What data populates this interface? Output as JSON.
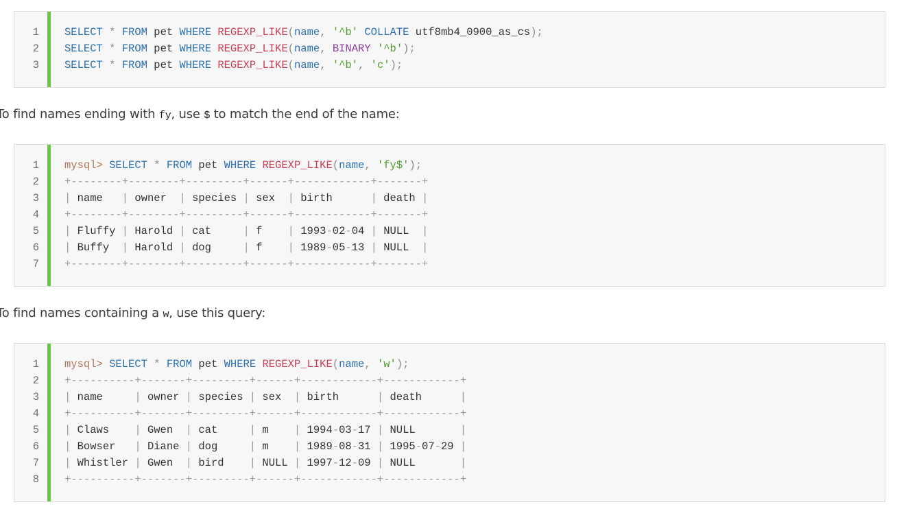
{
  "block1": {
    "lines": [
      "SELECT * FROM pet WHERE REGEXP_LIKE(name, '^b' COLLATE utf8mb4_0900_as_cs);",
      "SELECT * FROM pet WHERE REGEXP_LIKE(name, BINARY '^b');",
      "SELECT * FROM pet WHERE REGEXP_LIKE(name, '^b', 'c');"
    ]
  },
  "para1": {
    "before": "To find names ending with ",
    "code1": "fy",
    "middle": ", use ",
    "code2": "$",
    "after": " to match the end of the name:"
  },
  "block2": {
    "lines": [
      "mysql> SELECT * FROM pet WHERE REGEXP_LIKE(name, 'fy$');",
      "+--------+--------+---------+------+------------+-------+",
      "| name   | owner  | species | sex  | birth      | death |",
      "+--------+--------+---------+------+------------+-------+",
      "| Fluffy | Harold | cat     | f    | 1993-02-04 | NULL  |",
      "| Buffy  | Harold | dog     | f    | 1989-05-13 | NULL  |",
      "+--------+--------+---------+------+------------+-------+"
    ]
  },
  "para2": {
    "before": "To find names containing a ",
    "code1": "w",
    "after": ", use this query:"
  },
  "block3": {
    "lines": [
      "mysql> SELECT * FROM pet WHERE REGEXP_LIKE(name, 'w');",
      "+----------+-------+---------+------+------------+------------+",
      "| name     | owner | species | sex  | birth      | death      |",
      "+----------+-------+---------+------+------------+------------+",
      "| Claws    | Gwen  | cat     | m    | 1994-03-17 | NULL       |",
      "| Bowser   | Diane | dog     | m    | 1989-08-31 | 1995-07-29 |",
      "| Whistler | Gwen  | bird    | NULL | 1997-12-09 | NULL       |",
      "+----------+-------+---------+------+------------+------------+"
    ]
  },
  "colors": {
    "accent_bar": "#6cc644",
    "keyword": "#2a6fb0",
    "function": "#cc3d56",
    "string": "#559a2f",
    "prompt": "#b3775b"
  }
}
